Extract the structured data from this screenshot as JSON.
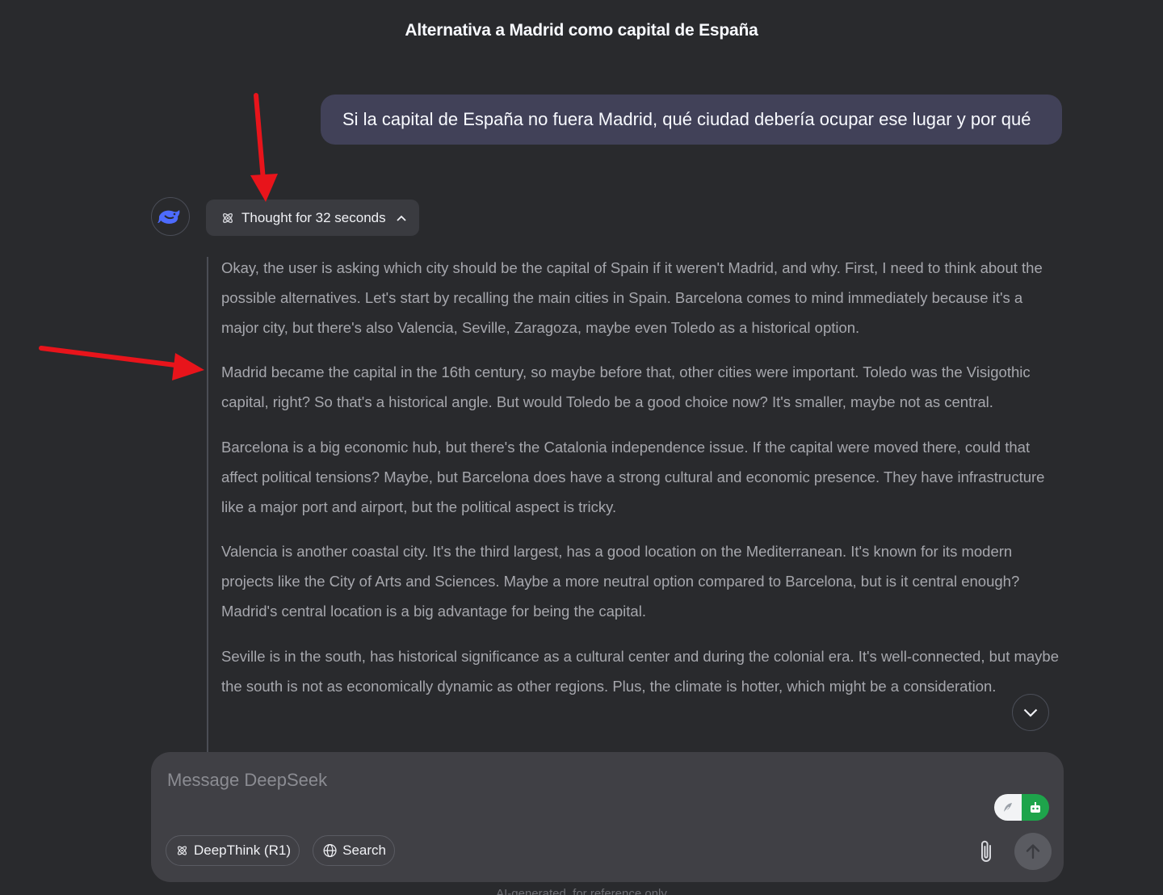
{
  "header": {
    "title": "Alternativa a Madrid como capital de España"
  },
  "user_message": {
    "text": "Si la capital de España no fuera Madrid, qué ciudad debería ocupar ese lugar y por qué"
  },
  "assistant": {
    "avatar_icon": "deepseek-whale-icon",
    "thought_label": "Thought for 32 seconds",
    "thinking": [
      "Okay, the user is asking which city should be the capital of Spain if it weren't Madrid, and why. First, I need to think about the possible alternatives. Let's start by recalling the main cities in Spain. Barcelona comes to mind immediately because it's a major city, but there's also Valencia, Seville, Zaragoza, maybe even Toledo as a historical option.",
      "Madrid became the capital in the 16th century, so maybe before that, other cities were important. Toledo was the Visigothic capital, right? So that's a historical angle. But would Toledo be a good choice now? It's smaller, maybe not as central.",
      "Barcelona is a big economic hub, but there's the Catalonia independence issue. If the capital were moved there, could that affect political tensions? Maybe, but Barcelona does have a strong cultural and economic presence. They have infrastructure like a major port and airport, but the political aspect is tricky.",
      "Valencia is another coastal city. It's the third largest, has a good location on the Mediterranean. It's known for its modern projects like the City of Arts and Sciences. Maybe a more neutral option compared to Barcelona, but is it central enough? Madrid's central location is a big advantage for being the capital.",
      "Seville is in the south, has historical significance as a cultural center and during the colonial era. It's well-connected, but maybe the south is not as economically dynamic as other regions. Plus, the climate is hotter, which might be a consideration."
    ]
  },
  "composer": {
    "placeholder": "Message DeepSeek",
    "deepthink_label": "DeepThink (R1)",
    "search_label": "Search"
  },
  "footer": {
    "text": "AI-generated, for reference only"
  },
  "colors": {
    "background": "#292a2d",
    "user_bubble": "#414158",
    "annotation_arrow": "#e8141b",
    "accent_blue": "#4d6bfe"
  }
}
